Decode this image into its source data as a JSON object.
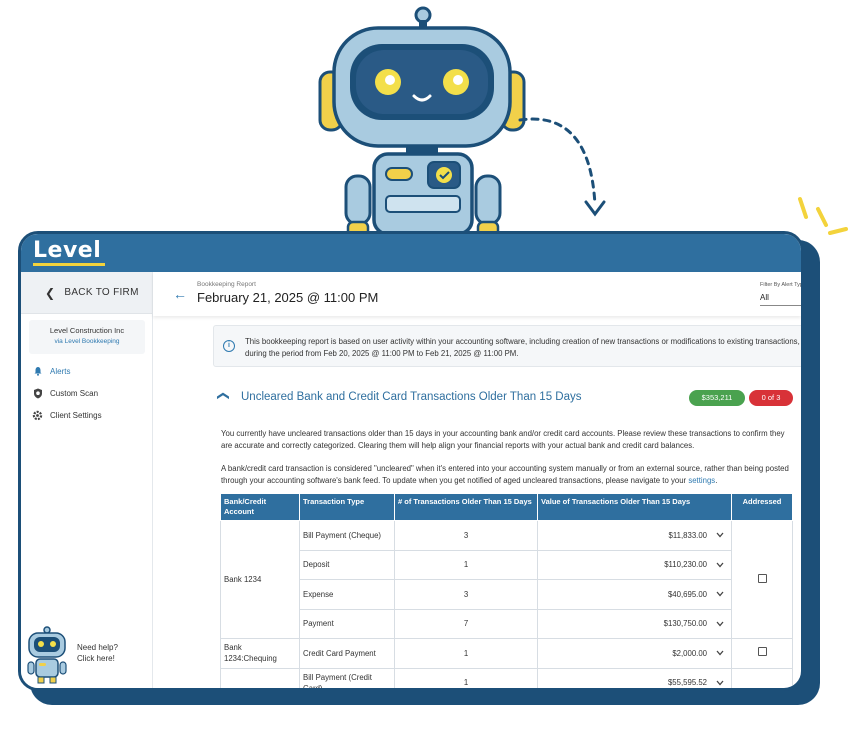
{
  "brand": {
    "logo_text": "Level",
    "frame_color": "#1c4f78",
    "topbar_color": "#2f6f9f",
    "accent": "#2f7ab0",
    "logo_underline": "#f3d33c"
  },
  "sidebar": {
    "back_label": "BACK TO FIRM",
    "client_name": "Level Construction Inc",
    "client_sub": "via Level Bookkeeping",
    "items": [
      {
        "label": "Alerts",
        "icon": "bell-icon",
        "active": true
      },
      {
        "label": "Custom Scan",
        "icon": "shield-icon",
        "active": false
      },
      {
        "label": "Client Settings",
        "icon": "gear-icon",
        "active": false
      }
    ],
    "help_line1": "Need help?",
    "help_line2": "Click here!"
  },
  "header": {
    "report_label": "Bookkeeping Report",
    "report_date": "February 21, 2025 @ 11:00 PM",
    "filter_label": "Filter By Alert Typ",
    "filter_value": "All"
  },
  "info": {
    "text": "This bookkeeping report is based on user activity within your accounting software, including creation of new transactions or modifications to existing transactions, during the period from Feb 20, 2025 @ 11:00 PM to Feb 21, 2025 @ 11:00 PM."
  },
  "section": {
    "title": "Uncleared Bank and Credit Card Transactions Older Than 15 Days",
    "amount_badge": "$353,211",
    "count_badge": "0 of 3",
    "para1": "You currently have uncleared transactions older than 15 days in your accounting bank and/or credit card accounts. Please review these transactions to confirm they are accurate and correctly categorized. Clearing them will help align your financial reports with your actual bank and credit card balances.",
    "para2_prefix": "A bank/credit card transaction is considered \"uncleared\" when it's entered into your accounting system manually or from an external source, rather than being posted through your accounting software's bank feed. To update when you get notified of aged uncleared transactions, please navigate to your ",
    "para2_link": "settings",
    "para2_suffix": "."
  },
  "table": {
    "headers": [
      "Bank/Credit Account",
      "Transaction Type",
      "# of Transactions Older Than 15 Days",
      "Value of Transactions Older Than 15 Days",
      "Addressed"
    ],
    "groups": [
      {
        "account": "Bank 1234",
        "rows": [
          {
            "type": "Bill Payment (Cheque)",
            "count": "3",
            "value": "$11,833.00"
          },
          {
            "type": "Deposit",
            "count": "1",
            "value": "$110,230.00"
          },
          {
            "type": "Expense",
            "count": "3",
            "value": "$40,695.00"
          },
          {
            "type": "Payment",
            "count": "7",
            "value": "$130,750.00"
          }
        ]
      },
      {
        "account": "Bank 1234:Chequing",
        "rows": [
          {
            "type": "Credit Card Payment",
            "count": "1",
            "value": "$2,000.00"
          }
        ]
      },
      {
        "account": "",
        "rows": [
          {
            "type": "Bill Payment (Credit Card)",
            "count": "1",
            "value": "$55,595.52"
          }
        ]
      }
    ]
  }
}
